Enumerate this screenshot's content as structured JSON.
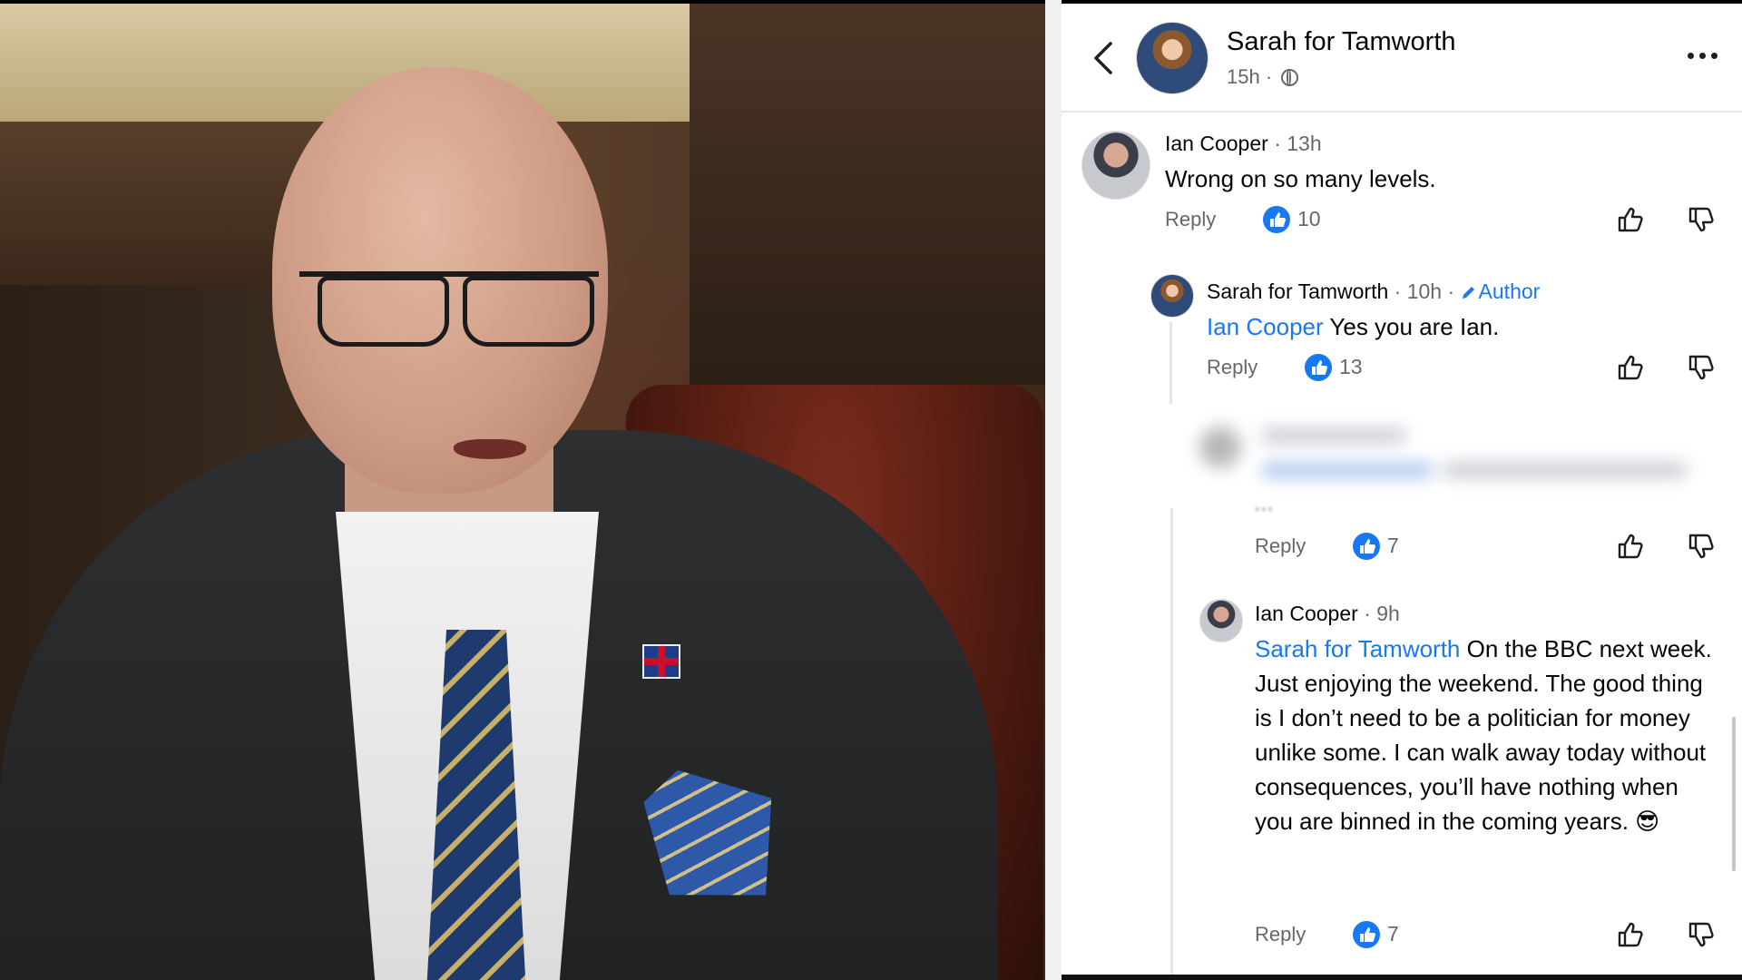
{
  "post": {
    "author": "Sarah for Tamworth",
    "time": "15h ·"
  },
  "comments": [
    {
      "author": "Ian Cooper",
      "time": " · 13h",
      "text": "Wrong on so many levels.",
      "reply_label": "Reply",
      "likes": "10"
    },
    {
      "author": "Sarah for Tamworth",
      "time": " · 10h · ",
      "badge": "Author",
      "mention": "Ian Cooper",
      "text": " Yes you are Ian.",
      "reply_label": "Reply",
      "likes": "13"
    },
    {
      "author": "",
      "text": "",
      "reply_label": "Reply",
      "likes": "7"
    },
    {
      "author": "Ian Cooper",
      "time": " · 9h",
      "mention": "Sarah for Tamworth",
      "text": " On the BBC next week. Just enjoying the weekend. The good thing is I don’t need to be a politician for money unlike some.  I can walk away today without consequences, you’ll have nothing when you are binned in the coming years. 😎",
      "reply_label": "Reply",
      "likes": "7"
    }
  ],
  "colors": {
    "accent": "#1877f2",
    "muted": "#65676b",
    "text": "#050505"
  },
  "icons": [
    "back-icon",
    "globe-icon",
    "more-icon",
    "like-reaction-icon",
    "thumbs-up-icon",
    "thumbs-down-icon",
    "pencil-icon"
  ]
}
